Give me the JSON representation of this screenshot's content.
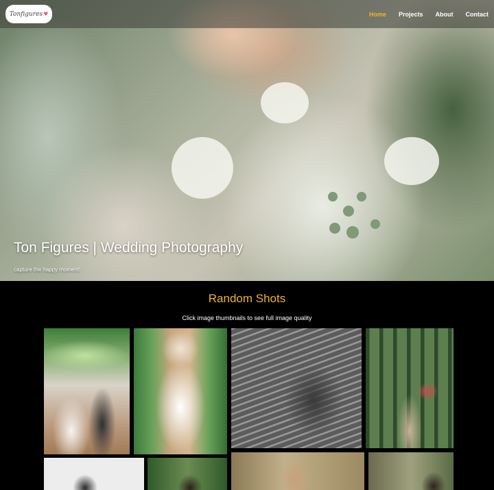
{
  "navbar": {
    "logo_text": "Tonfigures",
    "links": [
      {
        "label": "Home",
        "active": true
      },
      {
        "label": "Projects",
        "active": false
      },
      {
        "label": "About",
        "active": false
      },
      {
        "label": "Contact",
        "active": false
      }
    ]
  },
  "hero": {
    "title": "Ton Figures | Wedding Photography",
    "subtitle": "capture the happy moment!"
  },
  "gallery": {
    "title": "Random Shots",
    "subtitle": "Click image thumbnails to see full image quality"
  },
  "colors": {
    "accent": "#f0b429",
    "background": "#000000",
    "navbar_overlay": "rgba(60,60,55,0.55)"
  }
}
